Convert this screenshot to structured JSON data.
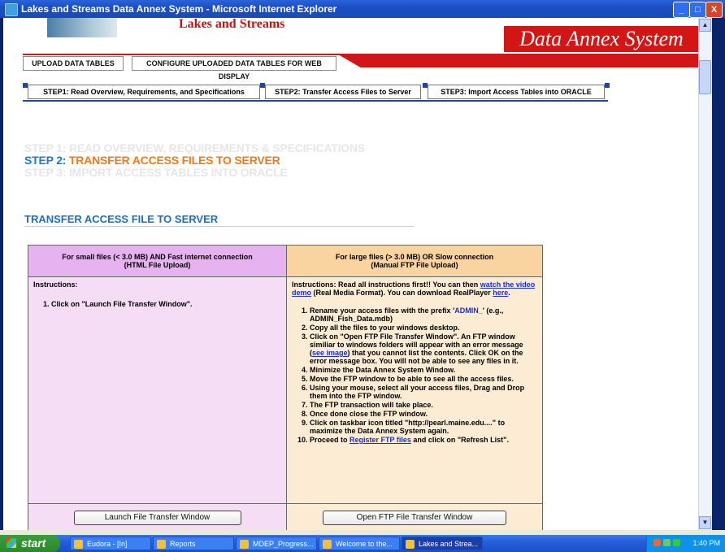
{
  "window": {
    "title": "Lakes and Streams Data Annex System - Microsoft Internet Explorer",
    "minimize_glyph": "_",
    "maximize_glyph": "□",
    "close_glyph": "X"
  },
  "header": {
    "logo_text": "Lakes and Streams",
    "banner_text": "Data Annex System"
  },
  "main_tabs": [
    "UPLOAD DATA TABLES",
    "CONFIGURE UPLOADED DATA TABLES FOR WEB DISPLAY"
  ],
  "step_tabs": [
    "STEP1: Read Overview, Requirements, and Specifications",
    "STEP2: Transfer Access Files to Server",
    "STEP3: Import Access Tables into ORACLE"
  ],
  "steps_heading": {
    "step1": "STEP 1: READ OVERVIEW, REQUIREMENTS & SPECIFICATIONS",
    "step2_prefix": "STEP 2: ",
    "step2_rest": "TRANSFER ACCESS FILES TO SERVER",
    "step3": "STEP 3: IMPORT ACCESS TABLES INTO ORACLE"
  },
  "section_title": "TRANSFER ACCESS FILE TO SERVER",
  "left_col": {
    "header_line1": "For small files (< 3.0 MB) AND Fast internet connection",
    "header_line2": "(HTML File Upload)",
    "instructions_label": "Instructions:",
    "step": "1.   Click on \"Launch File Transfer Window\".",
    "button": "Launch File Transfer Window"
  },
  "right_col": {
    "header_line1": "For large files (> 3.0 MB) OR Slow connection",
    "header_line2": "(Manual FTP File Upload)",
    "intro_a": "Instructions: Read all instructions first!! You can then ",
    "intro_link": "watch the video demo",
    "intro_b": " (Real Media Format). You can download RealPlayer ",
    "intro_link2": "here",
    "intro_c": ".",
    "steps": [
      {
        "a": "Rename your access files with the prefix '",
        "hl": "ADMIN_",
        "b": "' (e.g., ADMIN_Fish_Data.mdb)"
      },
      {
        "a": "Copy all the files to your windows desktop."
      },
      {
        "a": "Click on \"Open FTP File Transfer Window\". An FTP window similiar to windows folders will appear with an error message (",
        "link": "see image",
        "b": ") that you cannot list the contents. Click OK on the error message box. You will not be able to see any files in it."
      },
      {
        "a": "Minimize the Data Annex System Window."
      },
      {
        "a": "Move the FTP window to be able to see all the access files."
      },
      {
        "a": "Using your mouse, select all your access files, Drag and Drop them into the FTP window."
      },
      {
        "a": "The FTP transaction will take place."
      },
      {
        "a": "Once done close the FTP window."
      },
      {
        "a": "Click on taskbar icon titled \"http://pearl.maine.edu....\" to maximize the Data Annex System again."
      },
      {
        "a": "Proceed to ",
        "link": "Register FTP files",
        "b": " and click on \"Refresh List\"."
      }
    ],
    "button": "Open FTP File Transfer Window"
  },
  "taskbar": {
    "start": "start",
    "items": [
      "Eudora - [In]",
      "Reports",
      "MDEP_Progress...",
      "Welcome to the...",
      "Lakes and Strea..."
    ],
    "clock": "1:40 PM"
  },
  "colors": {
    "brand_red": "#d21515",
    "heading_blue": "#1e7ac8",
    "heading_orange": "#f07a18",
    "left_header": "#e6b2f0",
    "right_header": "#f9d3a0"
  }
}
